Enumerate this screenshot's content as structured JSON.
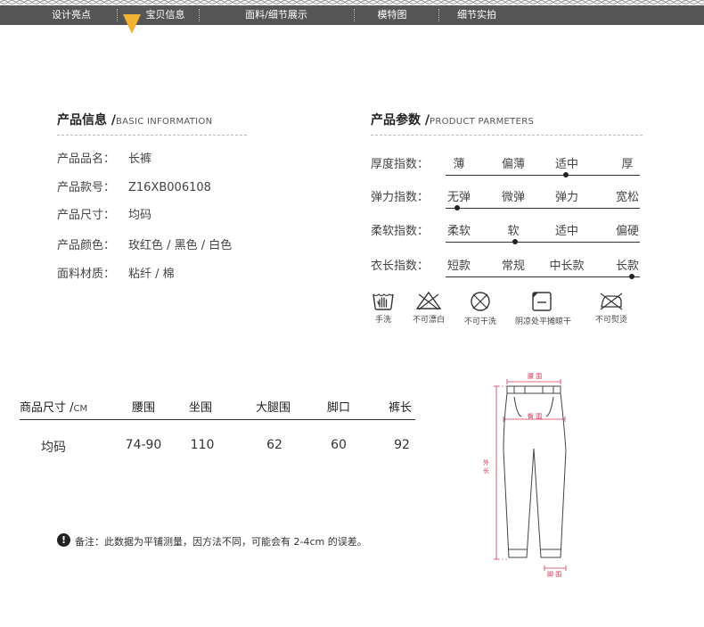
{
  "nav": {
    "items": [
      "设计亮点",
      "宝贝信息",
      "面料/细节展示",
      "模特图",
      "细节实拍"
    ],
    "active_index": 1,
    "accent": "#f2b233",
    "bar_color": "#555555"
  },
  "basic_info": {
    "title_cn": "产品信息 /",
    "title_en": "BASIC INFORMATION",
    "rows": [
      {
        "label": "产品品名：",
        "value": "长裤"
      },
      {
        "label": "产品款号：",
        "value": "Z16XB006108"
      },
      {
        "label": "产品尺寸：",
        "value": "均码"
      },
      {
        "label": "产品颜色：",
        "value": "玫红色 / 黑色 / 白色"
      },
      {
        "label": "面料材质：",
        "value": "粘纤 / 棉"
      }
    ]
  },
  "parameters": {
    "title_cn": "产品参数 /",
    "title_en": "PRODUCT PARMETERS",
    "rows": [
      {
        "label": "厚度指数：",
        "options": [
          "薄",
          "偏薄",
          "适中",
          "厚"
        ],
        "selected_fraction": 0.62
      },
      {
        "label": "弹力指数：",
        "options": [
          "无弹",
          "微弹",
          "弹力",
          "宽松"
        ],
        "selected_fraction": 0.06
      },
      {
        "label": "柔软指数：",
        "options": [
          "柔软",
          "软",
          "适中",
          "偏硬"
        ],
        "selected_fraction": 0.36
      },
      {
        "label": "衣长指数：",
        "options": [
          "短款",
          "常规",
          "中长款",
          "长款"
        ],
        "selected_fraction": 0.96
      }
    ]
  },
  "care": [
    {
      "icon": "hand-wash-icon",
      "label": "手洗"
    },
    {
      "icon": "no-bleach-icon",
      "label": "不可漂白"
    },
    {
      "icon": "no-tumble-dry-icon",
      "label": "不可干洗"
    },
    {
      "icon": "shade-dry-flat-icon",
      "label": "阴凉处平摊晾干"
    },
    {
      "icon": "no-iron-icon",
      "label": "不可熨烫"
    }
  ],
  "size_table": {
    "title_cn": "商品尺寸 /",
    "title_unit": "CM",
    "columns": [
      "腰围",
      "坐围",
      "大腿围",
      "脚口",
      "裤长"
    ],
    "row_label": "均码",
    "values": [
      "74-90",
      "110",
      "62",
      "60",
      "92"
    ]
  },
  "note": {
    "icon": "exclamation-icon",
    "text": "备注：此数据为平铺测量，因方法不同，可能会有 2-4cm 的误差。"
  },
  "diagram": {
    "labels": {
      "waist": "腰 围",
      "hip": "臀 围",
      "length": "外 长",
      "hem": "脚 围"
    },
    "measure_color": "#d23a5a"
  }
}
